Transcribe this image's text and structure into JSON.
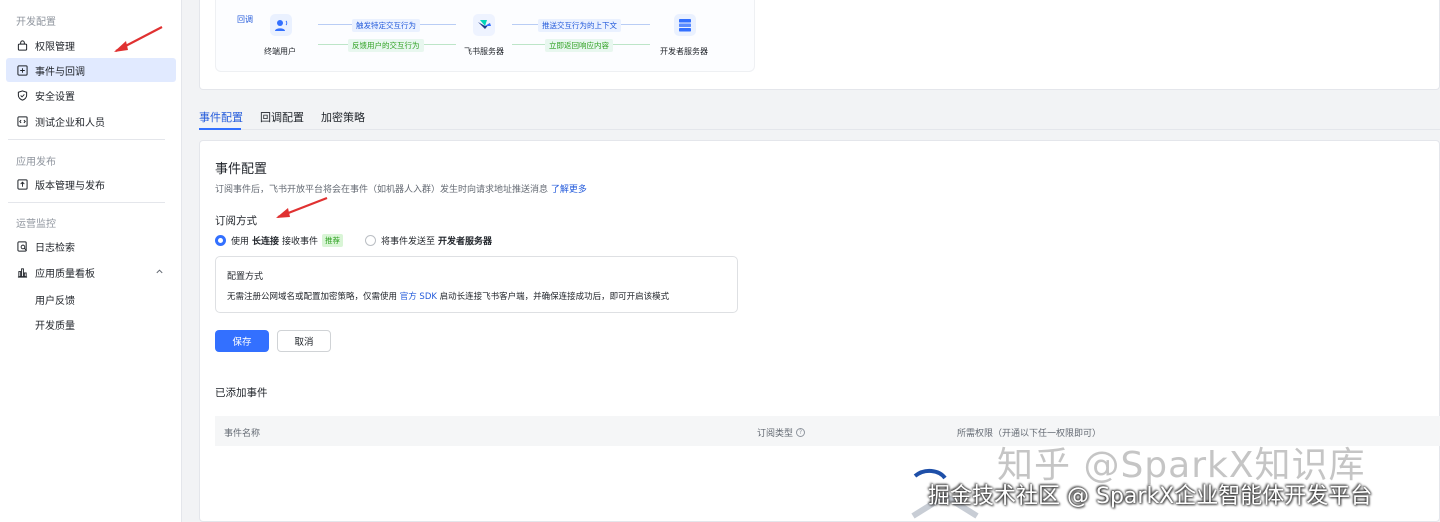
{
  "sidebar": {
    "sections": [
      {
        "title": "开发配置"
      },
      {
        "title": "应用发布"
      },
      {
        "title": "运营监控"
      }
    ],
    "items": {
      "permissions": "权限管理",
      "events": "事件与回调",
      "security": "安全设置",
      "test_org": "测试企业和人员",
      "version": "版本管理与发布",
      "log_search": "日志检索",
      "quality_board": "应用质量看板",
      "user_feedback": "用户反馈",
      "dev_quality": "开发质量"
    }
  },
  "flow": {
    "callback_tag": "回调",
    "end_user": "终端用户",
    "feishu_server": "飞书服务器",
    "dev_server": "开发者服务器",
    "trigger_label": "触发特定交互行为",
    "feedback_label": "反馈用户的交互行为",
    "push_context_label": "推送交互行为的上下文",
    "return_label": "立即返回响应内容"
  },
  "tabs": [
    "事件配置",
    "回调配置",
    "加密策略"
  ],
  "event_config": {
    "title": "事件配置",
    "description": "订阅事件后，飞书开放平台将会在事件（如机器人入群）发生时向请求地址推送消息",
    "learn_more": "了解更多",
    "subscription_title": "订阅方式",
    "option_long": {
      "prefix": "使用",
      "bold": "长连接",
      "suffix": "接收事件",
      "tag": "推荐"
    },
    "option_push": {
      "prefix": "将事件发送至",
      "bold": "开发者服务器"
    },
    "config_box_title": "配置方式",
    "config_text_before": "无需注册公网域名或配置加密策略，仅需使用",
    "config_text_link": "官方 SDK",
    "config_text_after": "启动长连接飞书客户端，并确保连接成功后，即可开启该模式",
    "save": "保存",
    "cancel": "取消",
    "added_events_title": "已添加事件",
    "columns": [
      "事件名称",
      "订阅类型",
      "所需权限（开通以下任一权限即可）"
    ]
  },
  "watermarks": {
    "zhihu": "知乎 @SparkX知识库",
    "juejin": "掘金技术社区 @ SparkX企业智能体开发平台"
  },
  "colors": {
    "accent": "#3370ff",
    "active_bg": "#e1eaff",
    "annotation_arrow": "#e03131"
  }
}
